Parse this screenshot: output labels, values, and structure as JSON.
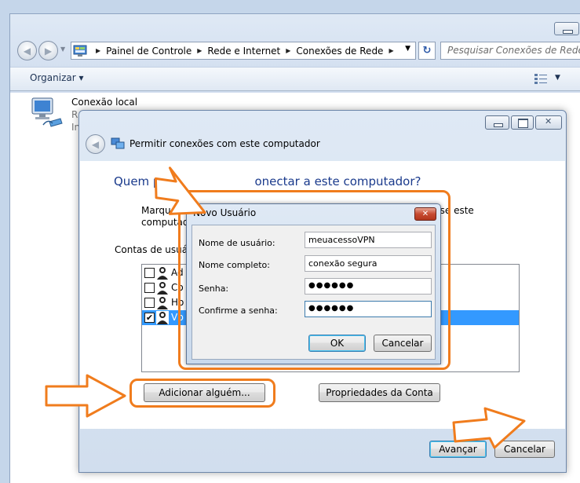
{
  "explorer": {
    "breadcrumb": [
      "Painel de Controle",
      "Rede e Internet",
      "Conexões de Rede"
    ],
    "search_placeholder": "Pesquisar Conexões de Rede",
    "organize_label": "Organizar",
    "connection": {
      "name": "Conexão local",
      "line2": "R",
      "line3": "In"
    }
  },
  "wizard": {
    "title": "Permitir conexões com este computador",
    "heading_part1": "Quem p",
    "heading_part2": "onectar a este computador?",
    "instruction_line1": "Marque a",
    "instruction_line2": "computad",
    "instruction_right": "esse este",
    "accounts_label": "Contas de usuári",
    "accounts": [
      {
        "name": "Ad",
        "checked": false,
        "selected": false
      },
      {
        "name": "Co",
        "checked": false,
        "selected": false
      },
      {
        "name": "Ho",
        "checked": false,
        "selected": false
      },
      {
        "name": "Vp",
        "checked": true,
        "selected": true
      }
    ],
    "add_button": "Adicionar alguém...",
    "properties_button": "Propriedades da Conta",
    "next_button": "Avançar",
    "cancel_button": "Cancelar"
  },
  "new_user": {
    "title": "Novo Usuário",
    "username_label": "Nome de usuário:",
    "username_value": "meuacessoVPN",
    "fullname_label": "Nome completo:",
    "fullname_value": "conexão segura",
    "password_label": "Senha:",
    "password_value": "●●●●●●",
    "confirm_label": "Confirme a senha:",
    "confirm_value": "●●●●●●",
    "ok_button": "OK",
    "cancel_button": "Cancelar"
  },
  "colors": {
    "annotation_orange": "#f07c1d",
    "heading_blue": "#1a3a8c",
    "selection_blue": "#3399ff"
  },
  "icons": [
    "back-arrow-icon",
    "forward-arrow-icon",
    "network-connection-icon",
    "refresh-icon",
    "views-icon",
    "user-icon",
    "close-icon"
  ]
}
